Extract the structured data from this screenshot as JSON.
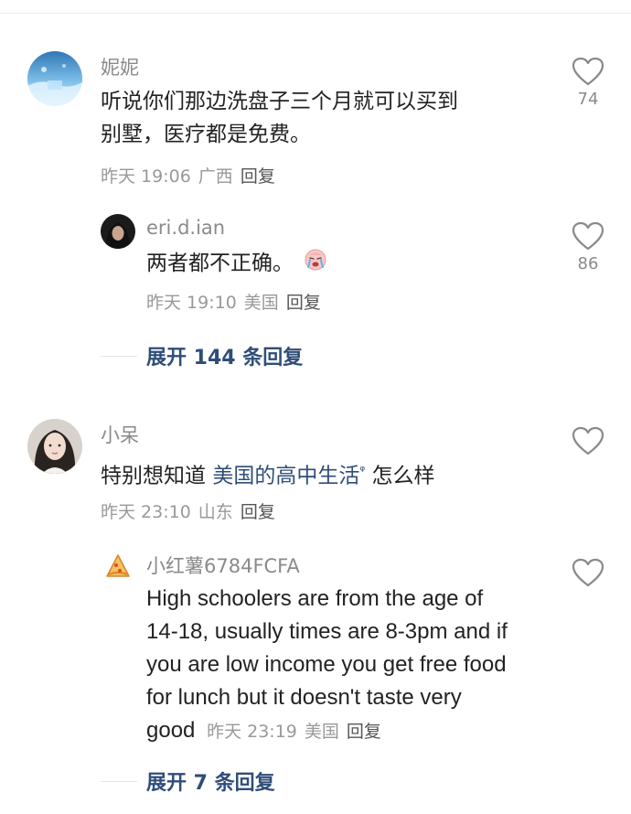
{
  "comments": [
    {
      "author": "妮妮",
      "text_line1": "听说你们那边洗盘子三个月就可以买到",
      "text_line2": "别墅，医疗都是免费。",
      "time": "昨天 19:06",
      "location": "广西",
      "reply_label": "回复",
      "likes": "74",
      "avatar_colors": [
        "#3b7fb8",
        "#bfe0f5"
      ],
      "replies": [
        {
          "author": "eri.d.ian",
          "text": "两者都不正确。",
          "emoji": "crying-face-icon",
          "time": "昨天 19:10",
          "location": "美国",
          "reply_label": "回复",
          "likes": "86"
        }
      ],
      "expand_label": "展开 144 条回复"
    },
    {
      "author": "小呆",
      "text_prefix": "特别想知道 ",
      "text_link": "美国的高中生活",
      "text_suffix": " 怎么样",
      "time": "昨天 23:10",
      "location": "山东",
      "reply_label": "回复",
      "replies": [
        {
          "author": "小红薯6784FCFA",
          "lines": [
            "High schoolers are from the age of",
            "14-18, usually times are 8-3pm and if",
            "you are low income you get free food",
            "for lunch but it doesn't taste very",
            "good"
          ],
          "time": "昨天 23:19",
          "location": "美国",
          "reply_label": "回复"
        }
      ],
      "expand_label": "展开 7 条回复"
    }
  ],
  "colors": {
    "link": "#2f4d78",
    "meta": "#999999",
    "author": "#8a8a8a"
  }
}
